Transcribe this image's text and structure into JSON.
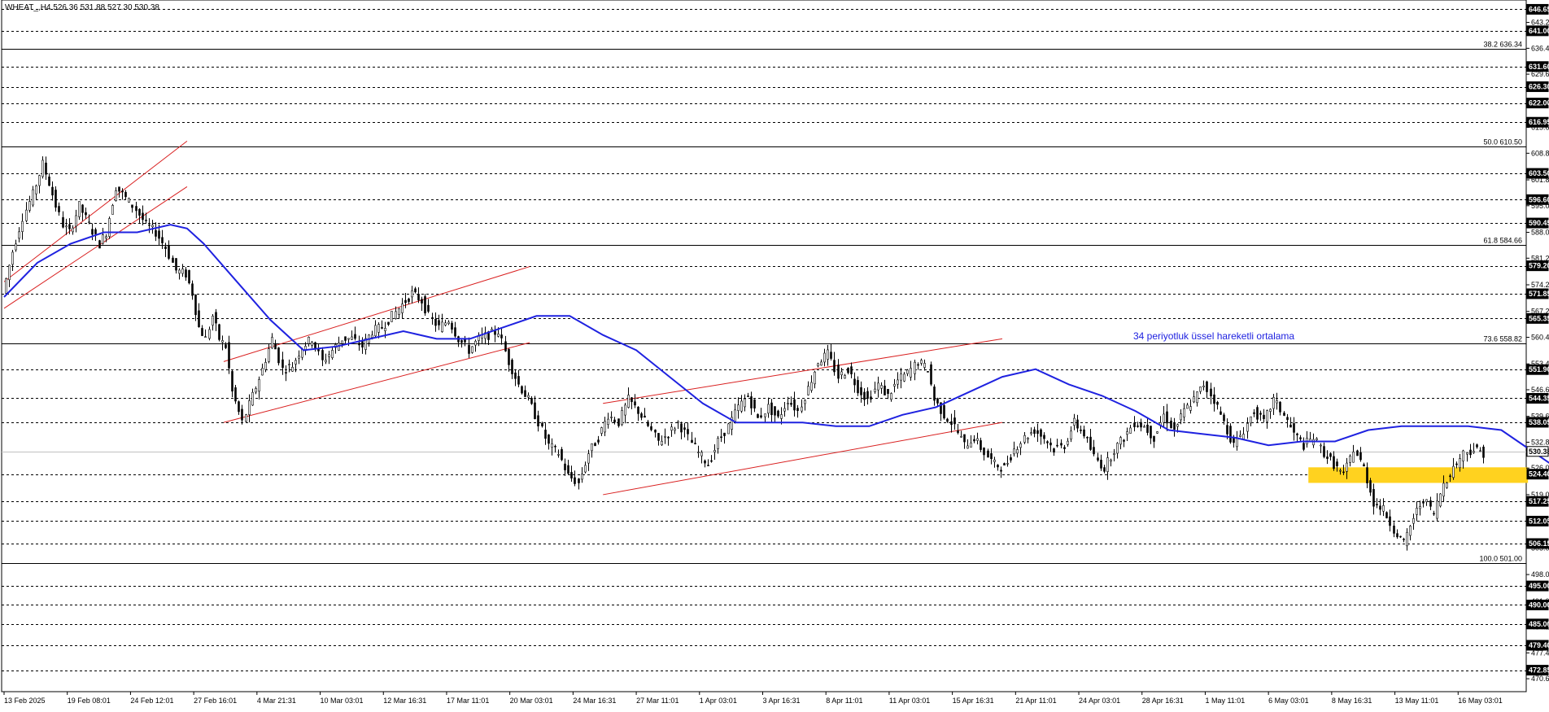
{
  "chart_data": {
    "type": "candlestick",
    "header_text": "WHEAT_,H4  526.36 531.88 527.30 530.38",
    "annotation_text": "34 periyotluk üssel hareketli ortalama",
    "y_range": [
      467.2,
      649.1
    ],
    "x_tick_labels": [
      "13 Feb 2025",
      "19 Feb 08:01",
      "24 Feb 12:01",
      "27 Feb 16:01",
      "4 Mar 21:31",
      "10 Mar 03:01",
      "12 Mar 16:31",
      "17 Mar 11:01",
      "20 Mar 03:01",
      "24 Mar 16:31",
      "27 Mar 11:01",
      "1 Apr 03:01",
      "3 Apr 16:31",
      "8 Apr 11:01",
      "11 Apr 03:01",
      "15 Apr 16:31",
      "21 Apr 11:01",
      "24 Apr 03:01",
      "28 Apr 16:31",
      "1 May 11:01",
      "6 May 03:01",
      "8 May 16:31",
      "13 May 11:01",
      "16 May 03:01"
    ],
    "y_tick_labels": [
      "470.60",
      "477.40",
      "484.20",
      "491.00",
      "498.00",
      "505.00",
      "512.00",
      "519.00",
      "526.00",
      "532.80",
      "539.60",
      "546.60",
      "553.40",
      "560.40",
      "567.20",
      "574.20",
      "581.20",
      "588.00",
      "595.00",
      "601.80",
      "608.80",
      "615.60",
      "622.60",
      "629.60",
      "636.40",
      "643.20"
    ],
    "boxed_levels": [
      "646.65",
      "641.00",
      "631.60",
      "626.30",
      "622.00",
      "616.95",
      "603.50",
      "596.60",
      "590.45",
      "579.20",
      "571.85",
      "565.35",
      "551.90",
      "544.35",
      "538.05",
      "530.38",
      "524.40",
      "517.25",
      "512.05",
      "506.15",
      "495.00",
      "490.00",
      "485.00",
      "479.40",
      "472.85"
    ],
    "fibonacci_levels": [
      {
        "label": "38.2 636.34",
        "value": 636.34
      },
      {
        "label": "50.0 610.50",
        "value": 610.5
      },
      {
        "label": "61.8 584.66",
        "value": 584.66
      },
      {
        "label": "73.6 558.82",
        "value": 558.82
      },
      {
        "label": "100.0 501.00",
        "value": 501.0
      }
    ],
    "current_price": 530.38,
    "highlight_zone": {
      "from": 522.1,
      "to": 526.2
    },
    "ema_series_name": "34 periyotluk üssel hareketli ortalama",
    "ema": [
      [
        0,
        571
      ],
      [
        10,
        580
      ],
      [
        20,
        585
      ],
      [
        30,
        588
      ],
      [
        40,
        588
      ],
      [
        50,
        590
      ],
      [
        55,
        589
      ],
      [
        60,
        585
      ],
      [
        70,
        575
      ],
      [
        80,
        565
      ],
      [
        90,
        557
      ],
      [
        100,
        558
      ],
      [
        110,
        560
      ],
      [
        120,
        562
      ],
      [
        130,
        560
      ],
      [
        140,
        560
      ],
      [
        150,
        563
      ],
      [
        160,
        566
      ],
      [
        170,
        566
      ],
      [
        180,
        561
      ],
      [
        190,
        557
      ],
      [
        200,
        550
      ],
      [
        210,
        543
      ],
      [
        220,
        538
      ],
      [
        230,
        538
      ],
      [
        240,
        538
      ],
      [
        250,
        537
      ],
      [
        260,
        537
      ],
      [
        270,
        540
      ],
      [
        280,
        542
      ],
      [
        290,
        546
      ],
      [
        300,
        550
      ],
      [
        310,
        552
      ],
      [
        320,
        548
      ],
      [
        330,
        545
      ],
      [
        340,
        541
      ],
      [
        350,
        536
      ],
      [
        360,
        535
      ],
      [
        370,
        534
      ],
      [
        380,
        532
      ],
      [
        390,
        533
      ],
      [
        400,
        533
      ],
      [
        410,
        536
      ],
      [
        420,
        537
      ],
      [
        430,
        537
      ],
      [
        440,
        537
      ],
      [
        450,
        536
      ],
      [
        460,
        530
      ],
      [
        470,
        524
      ],
      [
        480,
        523
      ],
      [
        490,
        525
      ]
    ],
    "price_path": [
      [
        0,
        572
      ],
      [
        3,
        583
      ],
      [
        6,
        592
      ],
      [
        9,
        598
      ],
      [
        12,
        606
      ],
      [
        14,
        601
      ],
      [
        16,
        595
      ],
      [
        18,
        590
      ],
      [
        20,
        588
      ],
      [
        23,
        595
      ],
      [
        26,
        590
      ],
      [
        29,
        585
      ],
      [
        31,
        588
      ],
      [
        34,
        600
      ],
      [
        37,
        597
      ],
      [
        40,
        594
      ],
      [
        43,
        590
      ],
      [
        46,
        588
      ],
      [
        49,
        584
      ],
      [
        52,
        578
      ],
      [
        55,
        577
      ],
      [
        57,
        572
      ],
      [
        59,
        563
      ],
      [
        61,
        560
      ],
      [
        63,
        566
      ],
      [
        65,
        560
      ],
      [
        67,
        558
      ],
      [
        69,
        546
      ],
      [
        72,
        538
      ],
      [
        75,
        545
      ],
      [
        78,
        552
      ],
      [
        81,
        560
      ],
      [
        84,
        552
      ],
      [
        87,
        553
      ],
      [
        90,
        558
      ],
      [
        93,
        560
      ],
      [
        96,
        554
      ],
      [
        99,
        557
      ],
      [
        102,
        560
      ],
      [
        105,
        560
      ],
      [
        108,
        558
      ],
      [
        111,
        562
      ],
      [
        114,
        563
      ],
      [
        117,
        566
      ],
      [
        120,
        569
      ],
      [
        123,
        572
      ],
      [
        126,
        570
      ],
      [
        128,
        566
      ],
      [
        131,
        563
      ],
      [
        134,
        565
      ],
      [
        137,
        560
      ],
      [
        140,
        557
      ],
      [
        143,
        560
      ],
      [
        146,
        561
      ],
      [
        149,
        562
      ],
      [
        152,
        554
      ],
      [
        155,
        548
      ],
      [
        158,
        544
      ],
      [
        161,
        538
      ],
      [
        164,
        532
      ],
      [
        167,
        530
      ],
      [
        170,
        524
      ],
      [
        173,
        522
      ],
      [
        176,
        530
      ],
      [
        179,
        534
      ],
      [
        182,
        540
      ],
      [
        185,
        538
      ],
      [
        188,
        544
      ],
      [
        191,
        541
      ],
      [
        194,
        537
      ],
      [
        197,
        533
      ],
      [
        200,
        535
      ],
      [
        203,
        538
      ],
      [
        206,
        534
      ],
      [
        209,
        530
      ],
      [
        212,
        527
      ],
      [
        215,
        533
      ],
      [
        218,
        537
      ],
      [
        221,
        542
      ],
      [
        224,
        545
      ],
      [
        227,
        539
      ],
      [
        230,
        542
      ],
      [
        233,
        539
      ],
      [
        236,
        544
      ],
      [
        239,
        541
      ],
      [
        242,
        547
      ],
      [
        245,
        554
      ],
      [
        248,
        556
      ],
      [
        251,
        550
      ],
      [
        254,
        552
      ],
      [
        257,
        547
      ],
      [
        260,
        544
      ],
      [
        263,
        548
      ],
      [
        266,
        545
      ],
      [
        269,
        549
      ],
      [
        272,
        551
      ],
      [
        275,
        554
      ],
      [
        278,
        552
      ],
      [
        280,
        544
      ],
      [
        283,
        540
      ],
      [
        286,
        537
      ],
      [
        289,
        532
      ],
      [
        292,
        534
      ],
      [
        295,
        530
      ],
      [
        298,
        527
      ],
      [
        301,
        526
      ],
      [
        304,
        531
      ],
      [
        307,
        534
      ],
      [
        310,
        536
      ],
      [
        313,
        534
      ],
      [
        316,
        531
      ],
      [
        319,
        532
      ],
      [
        322,
        538
      ],
      [
        325,
        535
      ],
      [
        328,
        529
      ],
      [
        331,
        526
      ],
      [
        334,
        531
      ],
      [
        337,
        534
      ],
      [
        340,
        538
      ],
      [
        343,
        537
      ],
      [
        346,
        534
      ],
      [
        349,
        540
      ],
      [
        352,
        536
      ],
      [
        355,
        541
      ],
      [
        358,
        544
      ],
      [
        361,
        548
      ],
      [
        364,
        544
      ],
      [
        367,
        538
      ],
      [
        370,
        532
      ],
      [
        373,
        536
      ],
      [
        376,
        541
      ],
      [
        379,
        538
      ],
      [
        382,
        544
      ],
      [
        385,
        540
      ],
      [
        388,
        535
      ],
      [
        391,
        532
      ],
      [
        394,
        534
      ],
      [
        397,
        530
      ],
      [
        400,
        527
      ],
      [
        403,
        524
      ],
      [
        406,
        531
      ],
      [
        409,
        526
      ],
      [
        412,
        517
      ],
      [
        415,
        515
      ],
      [
        418,
        510
      ],
      [
        421,
        506
      ],
      [
        424,
        513
      ],
      [
        427,
        518
      ],
      [
        430,
        514
      ],
      [
        433,
        522
      ],
      [
        436,
        526
      ],
      [
        439,
        530
      ],
      [
        442,
        531
      ],
      [
        445,
        530
      ]
    ],
    "price_path_x_range": [
      0,
      445
    ],
    "channels": [
      {
        "x1": 0,
        "y1": 575,
        "x2": 55,
        "y2": 612
      },
      {
        "x1": 0,
        "y1": 568,
        "x2": 55,
        "y2": 600
      },
      {
        "x1": 66,
        "y1": 554,
        "x2": 158,
        "y2": 579
      },
      {
        "x1": 66,
        "y1": 538,
        "x2": 158,
        "y2": 559
      },
      {
        "x1": 180,
        "y1": 543,
        "x2": 300,
        "y2": 560
      },
      {
        "x1": 180,
        "y1": 519,
        "x2": 300,
        "y2": 538
      }
    ],
    "channel_x_range": [
      0,
      300
    ]
  }
}
